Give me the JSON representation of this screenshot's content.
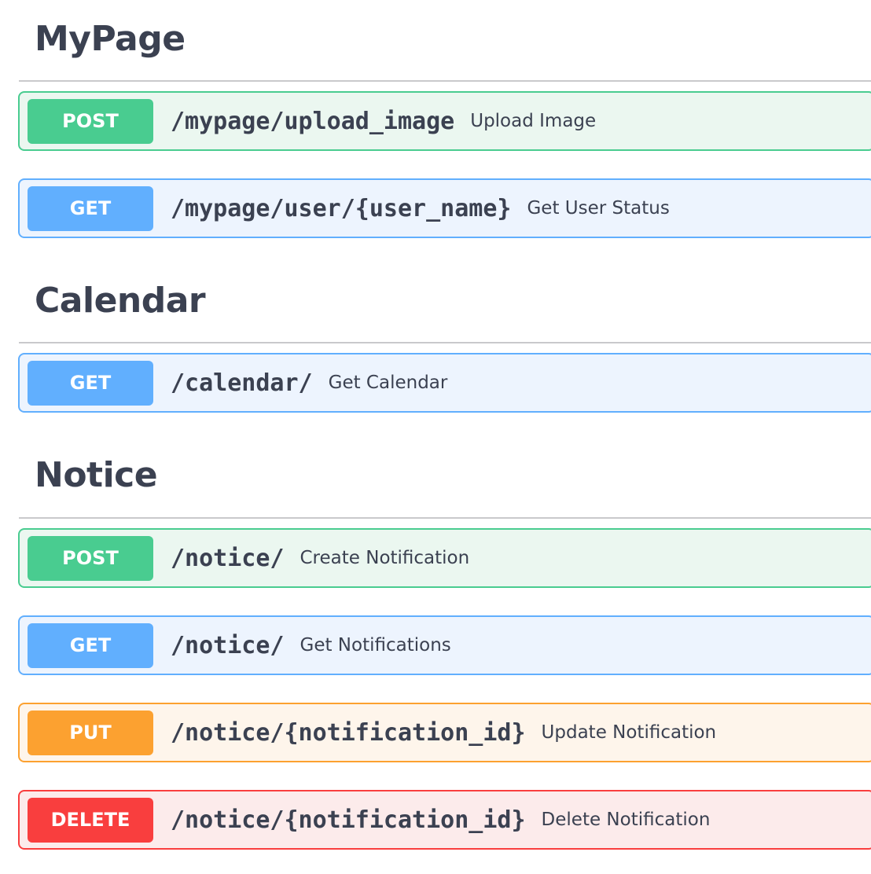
{
  "sections": [
    {
      "title": "MyPage",
      "operations": [
        {
          "method": "POST",
          "path": "/mypage/upload_image",
          "summary": "Upload Image"
        },
        {
          "method": "GET",
          "path": "/mypage/user/{user_name}",
          "summary": "Get User Status"
        }
      ]
    },
    {
      "title": "Calendar",
      "operations": [
        {
          "method": "GET",
          "path": "/calendar/",
          "summary": "Get Calendar"
        }
      ]
    },
    {
      "title": "Notice",
      "operations": [
        {
          "method": "POST",
          "path": "/notice/",
          "summary": "Create Notification"
        },
        {
          "method": "GET",
          "path": "/notice/",
          "summary": "Get Notifications"
        },
        {
          "method": "PUT",
          "path": "/notice/{notification_id}",
          "summary": "Update Notification"
        },
        {
          "method": "DELETE",
          "path": "/notice/{notification_id}",
          "summary": "Delete Notification"
        }
      ]
    }
  ],
  "colors": {
    "post": "#49cc90",
    "get": "#61affe",
    "put": "#fca130",
    "delete": "#f93e3e",
    "text": "#3b4151"
  }
}
